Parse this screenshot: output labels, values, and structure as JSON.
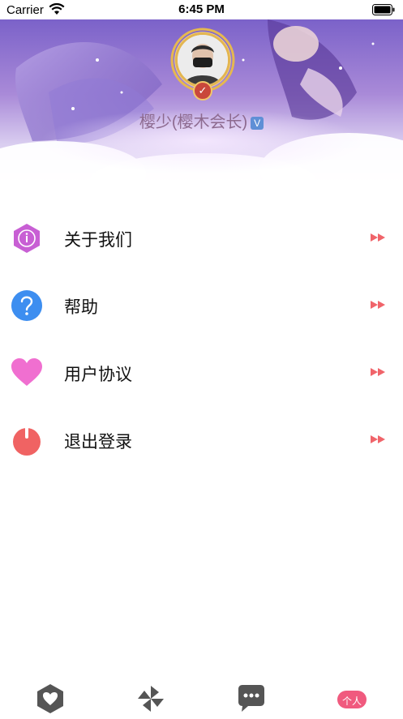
{
  "status_bar": {
    "carrier": "Carrier",
    "time": "6:45 PM"
  },
  "profile": {
    "username": "樱少(樱木会长)",
    "vip_badge": "V",
    "avatar_badge": "✓"
  },
  "menu": [
    {
      "label": "关于我们",
      "icon": "info-hexagon-icon",
      "color": "#c85fd4"
    },
    {
      "label": "帮助",
      "icon": "help-circle-icon",
      "color": "#3d8ef0"
    },
    {
      "label": "用户协议",
      "icon": "heart-icon",
      "color": "#f06fd0"
    },
    {
      "label": "退出登录",
      "icon": "power-icon",
      "color": "#f06363"
    }
  ],
  "arrow_color": "#f0646a",
  "tabbar": {
    "tabs": [
      {
        "icon": "shield-heart-icon"
      },
      {
        "icon": "pinwheel-icon"
      },
      {
        "icon": "chat-bubble-icon"
      },
      {
        "icon": "profile-tab-icon",
        "label": "个人",
        "active": true
      }
    ],
    "active_color": "#f05a7e",
    "inactive_color": "#555555"
  }
}
